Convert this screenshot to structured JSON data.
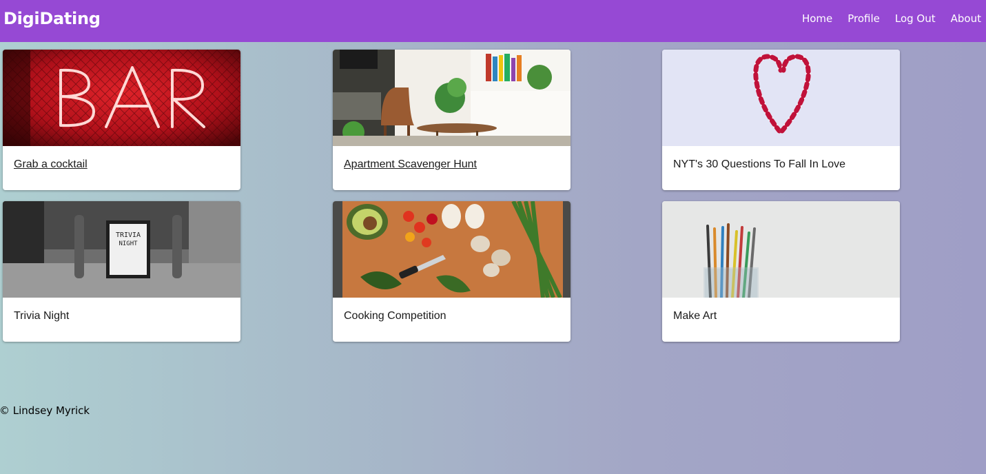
{
  "nav": {
    "brand": "DigiDating",
    "links": [
      "Home",
      "Profile",
      "Log Out",
      "About"
    ]
  },
  "cards": [
    {
      "title": "Grab a cocktail",
      "image": "neon-bar-sign-image",
      "is_link": true
    },
    {
      "title": "Apartment Scavenger Hunt",
      "image": "living-room-image",
      "is_link": true
    },
    {
      "title": "NYT's 30 Questions To Fall In Love",
      "image": "candy-cane-heart-image",
      "is_link": false
    },
    {
      "title": "Trivia Night",
      "image": "trivia-night-sign-image",
      "is_link": false
    },
    {
      "title": "Cooking Competition",
      "image": "vegetables-cutting-board-image",
      "is_link": false
    },
    {
      "title": "Make Art",
      "image": "paint-brushes-jar-image",
      "is_link": false
    }
  ],
  "footer": {
    "text": "© Lindsey Myrick"
  },
  "colors": {
    "navbar": "#9649d4",
    "card_background": "#ffffff"
  }
}
